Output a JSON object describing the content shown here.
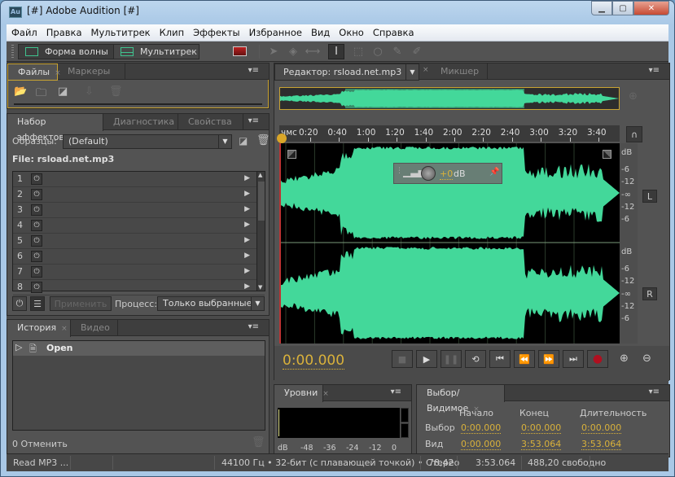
{
  "window": {
    "title": "[#] Adobe Audition [#]",
    "app_icon": "Au",
    "minimize_icon": "minimize-icon",
    "maximize_icon": "maximize-icon",
    "close_icon": "close-icon"
  },
  "menu": [
    "Файл",
    "Правка",
    "Мультитрек",
    "Клип",
    "Эффекты",
    "Избранное",
    "Вид",
    "Окно",
    "Справка"
  ],
  "toolbar": {
    "waveform_label": "Форма волны",
    "multitrack_label": "Мультитрек"
  },
  "files_panel": {
    "tabs": [
      "Файлы",
      "Маркеры"
    ],
    "active_tab": "Файлы"
  },
  "effects_panel": {
    "tabs": [
      "Набор эффектов",
      "Диагностика",
      "Свойства"
    ],
    "presets_label": "Образцы:",
    "presets_value": "(Default)",
    "file_label": "File: rsload.net.mp3",
    "rows": [
      "1",
      "2",
      "3",
      "4",
      "5",
      "6",
      "7",
      "8"
    ],
    "apply_label": "Применить",
    "process_label": "Процесс:",
    "process_value": "Только выбранные"
  },
  "history_panel": {
    "tabs": [
      "История",
      "Видео"
    ],
    "items": [
      {
        "label": "Open"
      }
    ],
    "undo_label": "0 Отменить"
  },
  "editor_panel": {
    "tab_label": "Редактор: rsload.net.mp3",
    "mixer_label": "Микшер",
    "time_unit": "чмс",
    "ruler_ticks": [
      "0:20",
      "0:40",
      "1:00",
      "1:20",
      "1:40",
      "2:00",
      "2:20",
      "2:40",
      "3:00",
      "3:20",
      "3:40"
    ],
    "db_scale_left": [
      "dB",
      "-6",
      "-12",
      "-∞",
      "-12",
      "-6"
    ],
    "db_scale_right": [
      "dB",
      "-6",
      "-12",
      "-∞",
      "-12",
      "-6"
    ],
    "channel_left": "L",
    "channel_right": "R",
    "hud_gain": "+0",
    "hud_unit": "dB",
    "current_time": "0:00.000",
    "waveform_color": "#43d89a"
  },
  "levels_panel": {
    "tab_label": "Уровни",
    "scale": [
      "dB",
      "-48",
      "-36",
      "-24",
      "-12",
      "0"
    ]
  },
  "selection_panel": {
    "tab_label": "Выбор/Видимое",
    "headers": [
      "Начало",
      "Конец",
      "Длительность"
    ],
    "rows": [
      {
        "label": "Выбор",
        "start": "0:00.000",
        "end": "0:00.000",
        "duration": "0:00.000"
      },
      {
        "label": "Вид",
        "start": "0:00.000",
        "end": "3:53.064",
        "duration": "3:53.064"
      }
    ]
  },
  "status": {
    "left": "Read MP3 ...",
    "format": "44100 Гц • 32-бит (с плавающей точкой) • Стерео",
    "size": "78,42",
    "duration": "3:53.064",
    "free": "488,20 свободно"
  }
}
